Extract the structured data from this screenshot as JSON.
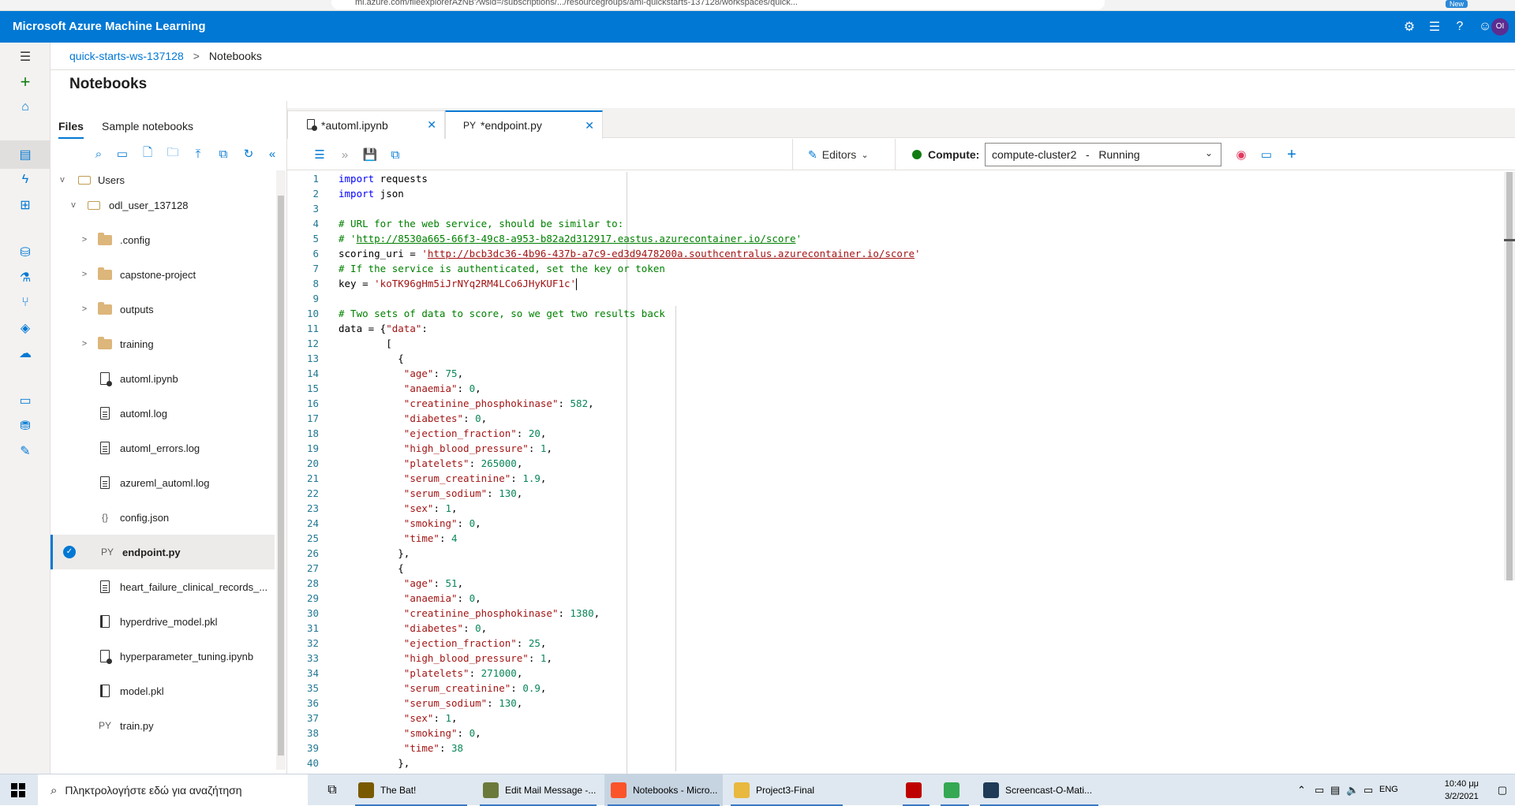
{
  "browser": {
    "url": "ml.azure.com/fileexplorerAzNB?wsid=/subscriptions/.../resourcegroups/aml-quickstarts-137128/workspaces/quick...",
    "new_badge": "New"
  },
  "topbar": {
    "brand": "Microsoft Azure Machine Learning",
    "icons": [
      "gear-icon",
      "feedback-icon",
      "help-icon",
      "smiley-icon"
    ],
    "avatar_initials": "OI",
    "color": "#0078d4"
  },
  "breadcrumb": {
    "workspace": "quick-starts-ws-137128",
    "separator": ">",
    "current": "Notebooks"
  },
  "page_title": "Notebooks",
  "filepane": {
    "tabs": [
      "Files",
      "Sample notebooks"
    ],
    "toolbar_icons": [
      "search-icon",
      "terminal-icon",
      "new-file-icon",
      "new-folder-icon",
      "upload-icon",
      "copy-icon",
      "refresh-icon",
      "collapse-icon"
    ],
    "tree": [
      {
        "label": "Users",
        "type": "root",
        "chev": "v"
      },
      {
        "label": "odl_user_137128",
        "type": "user",
        "chev": "v"
      },
      {
        "label": ".config",
        "type": "folder",
        "chev": ">"
      },
      {
        "label": "capstone-project",
        "type": "folder",
        "chev": ">"
      },
      {
        "label": "outputs",
        "type": "folder",
        "chev": ">"
      },
      {
        "label": "training",
        "type": "folder",
        "chev": ">"
      },
      {
        "label": "automl.ipynb",
        "type": "notebook"
      },
      {
        "label": "automl.log",
        "type": "doc"
      },
      {
        "label": "automl_errors.log",
        "type": "doc"
      },
      {
        "label": "azureml_automl.log",
        "type": "doc"
      },
      {
        "label": "config.json",
        "type": "json",
        "icon_text": "{}"
      },
      {
        "label": "endpoint.py",
        "type": "py",
        "icon_text": "PY",
        "selected": true
      },
      {
        "label": "heart_failure_clinical_records_...",
        "type": "doc"
      },
      {
        "label": "hyperdrive_model.pkl",
        "type": "pkl"
      },
      {
        "label": "hyperparameter_tuning.ipynb",
        "type": "notebook"
      },
      {
        "label": "model.pkl",
        "type": "pkl"
      },
      {
        "label": "train.py",
        "type": "py",
        "icon_text": "PY"
      }
    ]
  },
  "editor": {
    "tabs": [
      {
        "label": "*automl.ipynb",
        "active": false
      },
      {
        "label": "*endpoint.py",
        "prefix": "PY",
        "active": true
      }
    ],
    "toolbar": {
      "editors_label": "Editors",
      "compute_label": "Compute:",
      "compute_value": "compute-cluster2   -   Running",
      "status_color": "#107c10"
    }
  },
  "code_lines": [
    "import requests",
    "import json",
    "",
    "# URL for the web service, should be similar to:",
    "# 'http://8530a665-66f3-49c8-a953-b82a2d312917.eastus.azurecontainer.io/score'",
    "scoring_uri = 'http://bcb3dc36-4b96-437b-a7c9-ed3d9478200a.southcentralus.azurecontainer.io/score'",
    "# If the service is authenticated, set the key or token",
    "key = 'koTK96gHm5iJrNYq2RM4LCo6JHyKUF1c'",
    "",
    "# Two sets of data to score, so we get two results back",
    "data = {\"data\":",
    "        [",
    "          {",
    "           \"age\": 75,",
    "           \"anaemia\": 0,",
    "           \"creatinine_phosphokinase\": 582,",
    "           \"diabetes\": 0,",
    "           \"ejection_fraction\": 20,",
    "           \"high_blood_pressure\": 1,",
    "           \"platelets\": 265000,",
    "           \"serum_creatinine\": 1.9,",
    "           \"serum_sodium\": 130,",
    "           \"sex\": 1,",
    "           \"smoking\": 0,",
    "           \"time\": 4",
    "          },",
    "          {",
    "           \"age\": 51,",
    "           \"anaemia\": 0,",
    "           \"creatinine_phosphokinase\": 1380,",
    "           \"diabetes\": 0,",
    "           \"ejection_fraction\": 25,",
    "           \"high_blood_pressure\": 1,",
    "           \"platelets\": 271000,",
    "           \"serum_creatinine\": 0.9,",
    "           \"serum_sodium\": 130,",
    "           \"sex\": 1,",
    "           \"smoking\": 0,",
    "           \"time\": 38",
    "          },",
    "        ]"
  ],
  "taskbar": {
    "search_placeholder": "Πληκτρολογήστε εδώ για αναζήτηση",
    "items": [
      {
        "label": "The Bat!",
        "icon": "bat-icon",
        "color": "#7a5a00"
      },
      {
        "label": "Edit Mail Message -...",
        "icon": "mail-edit-icon",
        "color": "#6b7a3a"
      },
      {
        "label": "Notebooks - Micro...",
        "icon": "brave-icon",
        "color": "#fb542b",
        "active": true
      },
      {
        "label": "Project3-Final",
        "icon": "folder-icon",
        "color": "#e8b83f"
      },
      {
        "label": "",
        "icon": "filezilla-icon",
        "color": "#bf0000"
      },
      {
        "label": "",
        "icon": "chrome-icon",
        "color": "#34a853"
      },
      {
        "label": "Screencast-O-Mati...",
        "icon": "screencast-icon",
        "color": "#1f3b57"
      }
    ],
    "lang": "ENG",
    "time": "10:40 μμ",
    "date": "3/2/2021"
  }
}
